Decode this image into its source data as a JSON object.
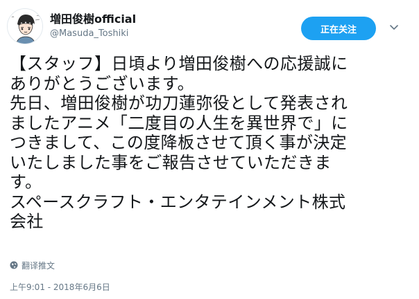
{
  "user": {
    "display_name": "増田俊樹official",
    "handle": "@Masuda_Toshiki",
    "avatar_icon": "user-avatar-illustration"
  },
  "follow_button": {
    "label": "正在关注"
  },
  "menu_icon": "chevron-down-icon",
  "tweet": {
    "lines": [
      "【スタッフ】日頃より増田俊樹への応援誠に",
      "ありがとうございます。",
      "先日、増田俊樹が功刀蓮弥役として発表され",
      "ましたアニメ「二度目の人生を異世界で」に",
      "つきまして、この度降板させて頂く事が決定",
      "いたしました事をご報告させていただきま",
      "す。",
      "スペースクラフト・エンタテインメント株式",
      "会社"
    ]
  },
  "translate": {
    "label": "翻译推文",
    "icon": "globe-icon"
  },
  "timestamp": "上午9:01 - 2018年6月6日",
  "colors": {
    "accent": "#1da1f2",
    "text": "#14171a",
    "secondary_text": "#657786"
  }
}
